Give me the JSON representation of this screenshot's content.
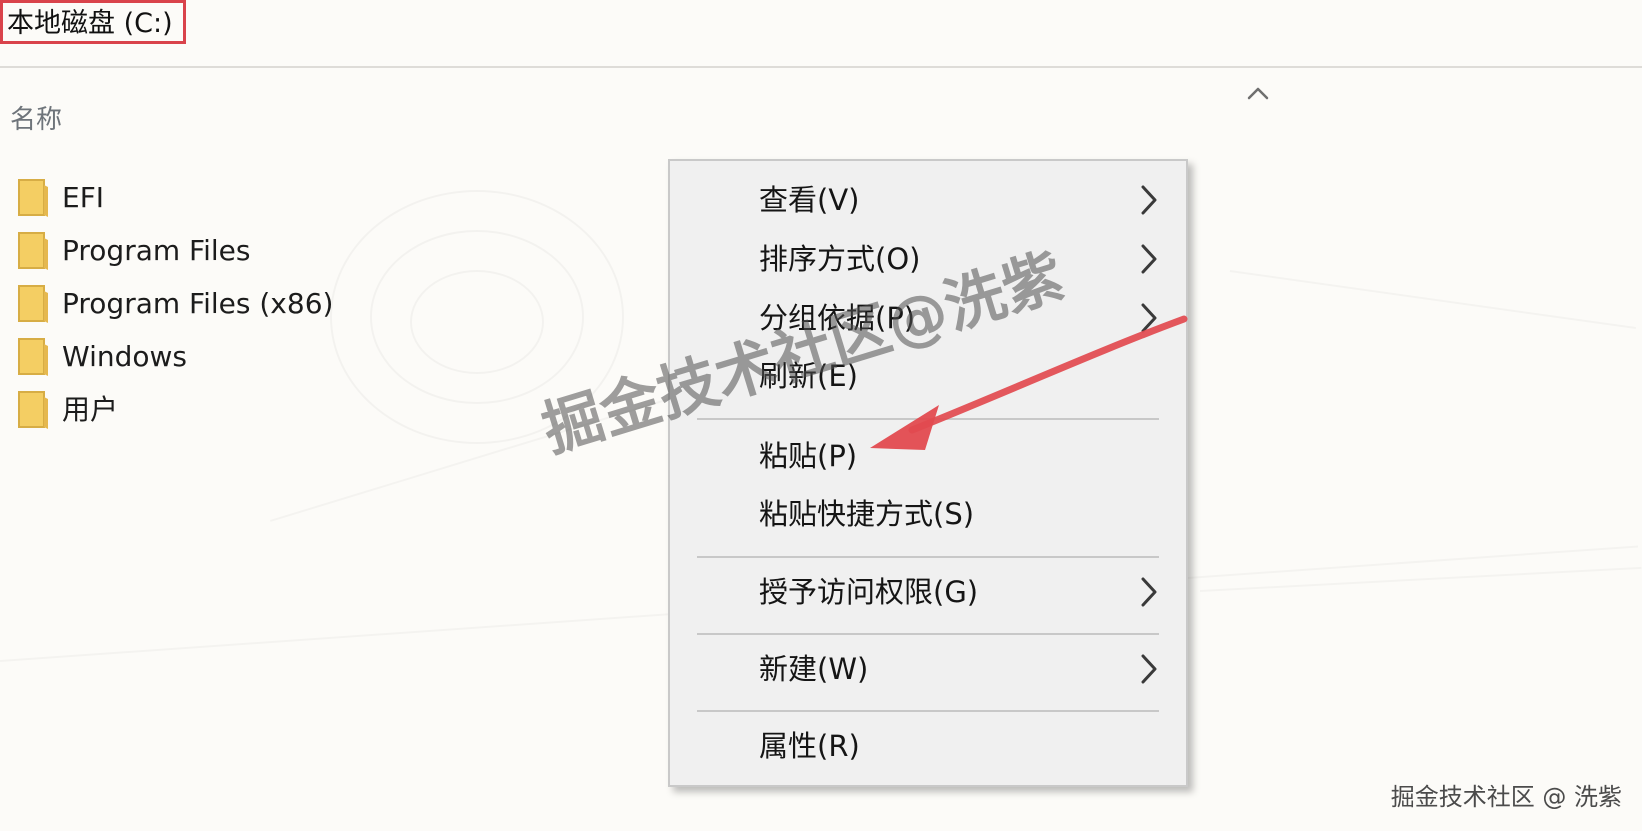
{
  "window": {
    "title": "本地磁盘 (C:)"
  },
  "file_list": {
    "column_header": "名称",
    "sort_icon": "chevron-up-icon",
    "items": [
      {
        "name": "EFI",
        "icon": "folder-icon"
      },
      {
        "name": "Program Files",
        "icon": "folder-icon"
      },
      {
        "name": "Program Files (x86)",
        "icon": "folder-icon"
      },
      {
        "name": "Windows",
        "icon": "folder-icon"
      },
      {
        "name": "用户",
        "icon": "folder-icon"
      }
    ]
  },
  "context_menu": {
    "items": [
      {
        "label": "查看(V)",
        "submenu": true
      },
      {
        "label": "排序方式(O)",
        "submenu": true
      },
      {
        "label": "分组依据(P)",
        "submenu": true
      },
      {
        "label": "刷新(E)",
        "submenu": false
      },
      {
        "label": "粘贴(P)",
        "submenu": false
      },
      {
        "label": "粘贴快捷方式(S)",
        "submenu": false
      },
      {
        "label": "授予访问权限(G)",
        "submenu": true
      },
      {
        "label": "新建(W)",
        "submenu": true
      },
      {
        "label": "属性(R)",
        "submenu": false
      }
    ]
  },
  "watermark": {
    "center_text": "掘金技术社区@洗紫",
    "corner_text": "掘金技术社区 @ 洗紫"
  },
  "colors": {
    "highlight_border": "#d9434b",
    "annotation_arrow": "#e24a4f",
    "folder": "#f4ce63",
    "background": "#fcfbf8",
    "menu_background": "#f0f0f0"
  }
}
